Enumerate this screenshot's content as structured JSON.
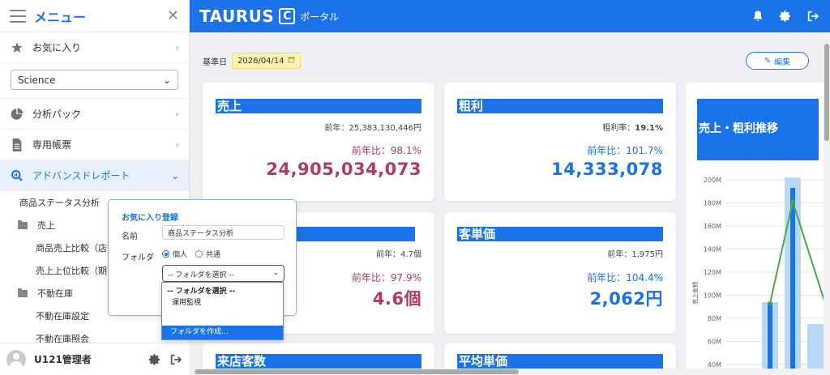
{
  "sidebar": {
    "title": "メニュー",
    "favorites": "お気に入り",
    "select_value": "Science",
    "items": [
      {
        "label": "分析パック"
      },
      {
        "label": "専用帳票"
      },
      {
        "label": "アドバンスドレポート"
      }
    ],
    "sub": [
      {
        "label": "商品ステータス分析"
      },
      {
        "label": "売上"
      },
      {
        "label": "商品売上比較（店舗"
      },
      {
        "label": "売上上位比較（期間"
      },
      {
        "label": "不動在庫"
      },
      {
        "label": "不動在庫設定"
      },
      {
        "label": "不動在庫照会"
      }
    ],
    "user": "U121管理者"
  },
  "header": {
    "logo": "TAURUS",
    "logo_mark": "C",
    "logo_sub": "ポータル"
  },
  "toolbar": {
    "kijun_label": "基準日",
    "date": "2026/04/14",
    "edit_label": "編集"
  },
  "cards": [
    {
      "title": "売上",
      "prev": "前年：25,383,130,446円",
      "ratio": "前年比：98.1%",
      "value": "24,905,034,073"
    },
    {
      "title": "粗利",
      "prev_label": "粗利率：",
      "prev_value": "19.1%",
      "ratio": "前年比：101.7%",
      "value": "14,333,078"
    },
    {
      "title": "",
      "prev": "前年：4.7個",
      "ratio": "前年比：97.9%",
      "value": "4.6個"
    },
    {
      "title": "客単価",
      "prev": "前年：1,975円",
      "ratio": "前年比：104.4%",
      "value": "2,062円"
    },
    {
      "title": "来店客数"
    },
    {
      "title": "平均単価"
    }
  ],
  "chart_card": {
    "title": "売上・粗利推移"
  },
  "chart_data": {
    "type": "bar",
    "ylabel": "売上金額",
    "ylim": [
      40,
      200
    ],
    "yticks": [
      "200M",
      "180M",
      "160M",
      "140M",
      "120M",
      "100M",
      "80M",
      "60M",
      "40M"
    ],
    "series": [
      {
        "values": [
          94,
          202,
          75
        ]
      },
      {
        "values": [
          193
        ]
      },
      {
        "values": [
          93,
          181
        ]
      }
    ],
    "colors": {
      "bar_light": "#b9d8f6",
      "bar_dark": "#1a73e8",
      "line": "#4aa84a"
    }
  },
  "popup": {
    "title": "お気に入り登録",
    "name_label": "名前",
    "name_value": "商品ステータス分析",
    "folder_label": "フォルダ",
    "radio_personal": "個人",
    "radio_shared": "共通",
    "select_value": "-- フォルダを選択 --",
    "options": [
      "-- フォルダを選択 --",
      "運用監視",
      "フォルダを作成…"
    ]
  }
}
